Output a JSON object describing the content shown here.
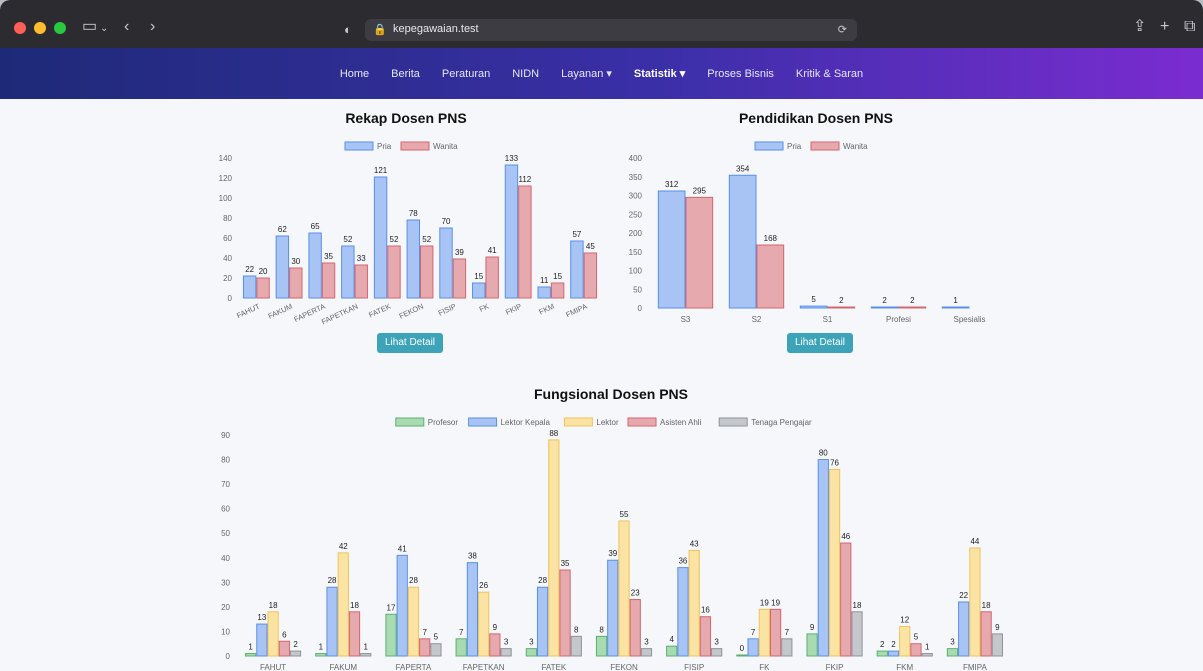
{
  "browser": {
    "url": "kepegawaian.test"
  },
  "nav": {
    "items": [
      "Home",
      "Berita",
      "Peraturan",
      "NIDN",
      "Layanan ▾",
      "Statistik ▾",
      "Proses Bisnis",
      "Kritik & Saran"
    ],
    "active_index": 5
  },
  "button_label": "Lihat Detail",
  "colors": {
    "pria_fill": "#a7c4f5",
    "pria_stroke": "#5a8fe8",
    "wanita_fill": "#e5a9ae",
    "wanita_stroke": "#d4666f",
    "profesor_fill": "#a9dbb2",
    "profesor_stroke": "#5db06c",
    "lektor_fill": "#fbe3a4",
    "lektor_stroke": "#efc45a",
    "tenaga_fill": "#c4c7cc",
    "tenaga_stroke": "#8e9399"
  },
  "chart_data": [
    {
      "type": "bar",
      "title": "Rekap Dosen PNS",
      "categories": [
        "FAHUT",
        "FAKUM",
        "FAPERTA",
        "FAPETKAN",
        "FATEK",
        "FEKON",
        "FISIP",
        "FK",
        "FKIP",
        "FKM",
        "FMIPA"
      ],
      "series": [
        {
          "name": "Pria",
          "values": [
            22,
            62,
            65,
            52,
            121,
            78,
            70,
            15,
            133,
            11,
            57
          ]
        },
        {
          "name": "Wanita",
          "values": [
            20,
            30,
            35,
            33,
            52,
            52,
            39,
            41,
            112,
            15,
            45
          ]
        }
      ],
      "ylim": [
        0,
        140
      ],
      "yticks": [
        0,
        20,
        40,
        60,
        80,
        100,
        120,
        140
      ],
      "legend": "top"
    },
    {
      "type": "bar",
      "title": "Pendidikan Dosen PNS",
      "categories": [
        "S3",
        "S2",
        "S1",
        "Profesi",
        "Spesialis"
      ],
      "series": [
        {
          "name": "Pria",
          "values": [
            312,
            354,
            5,
            2,
            1
          ]
        },
        {
          "name": "Wanita",
          "values": [
            295,
            168,
            2,
            2,
            null
          ]
        }
      ],
      "ylim": [
        0,
        400
      ],
      "yticks": [
        0,
        50,
        100,
        150,
        200,
        250,
        300,
        350,
        400
      ],
      "legend": "top"
    },
    {
      "type": "bar",
      "title": "Fungsional Dosen PNS",
      "categories": [
        "FAHUT",
        "FAKUM",
        "FAPERTA",
        "FAPETKAN",
        "FATEK",
        "FEKON",
        "FISIP",
        "FK",
        "FKIP",
        "FKM",
        "FMIPA"
      ],
      "series": [
        {
          "name": "Profesor",
          "values": [
            1,
            1,
            17,
            7,
            3,
            8,
            4,
            0,
            9,
            2,
            3
          ]
        },
        {
          "name": "Lektor Kepala",
          "values": [
            13,
            28,
            41,
            38,
            28,
            39,
            36,
            7,
            80,
            2,
            22
          ]
        },
        {
          "name": "Lektor",
          "values": [
            18,
            42,
            28,
            26,
            88,
            55,
            43,
            19,
            76,
            12,
            44
          ]
        },
        {
          "name": "Asisten Ahli",
          "values": [
            6,
            18,
            7,
            9,
            35,
            23,
            16,
            19,
            46,
            5,
            18
          ]
        },
        {
          "name": "Tenaga Pengajar",
          "values": [
            2,
            1,
            5,
            3,
            8,
            3,
            3,
            7,
            18,
            1,
            9
          ]
        }
      ],
      "ylim": [
        0,
        90
      ],
      "yticks": [
        0,
        10,
        20,
        30,
        40,
        50,
        60,
        70,
        80,
        90
      ],
      "legend": "top"
    }
  ]
}
